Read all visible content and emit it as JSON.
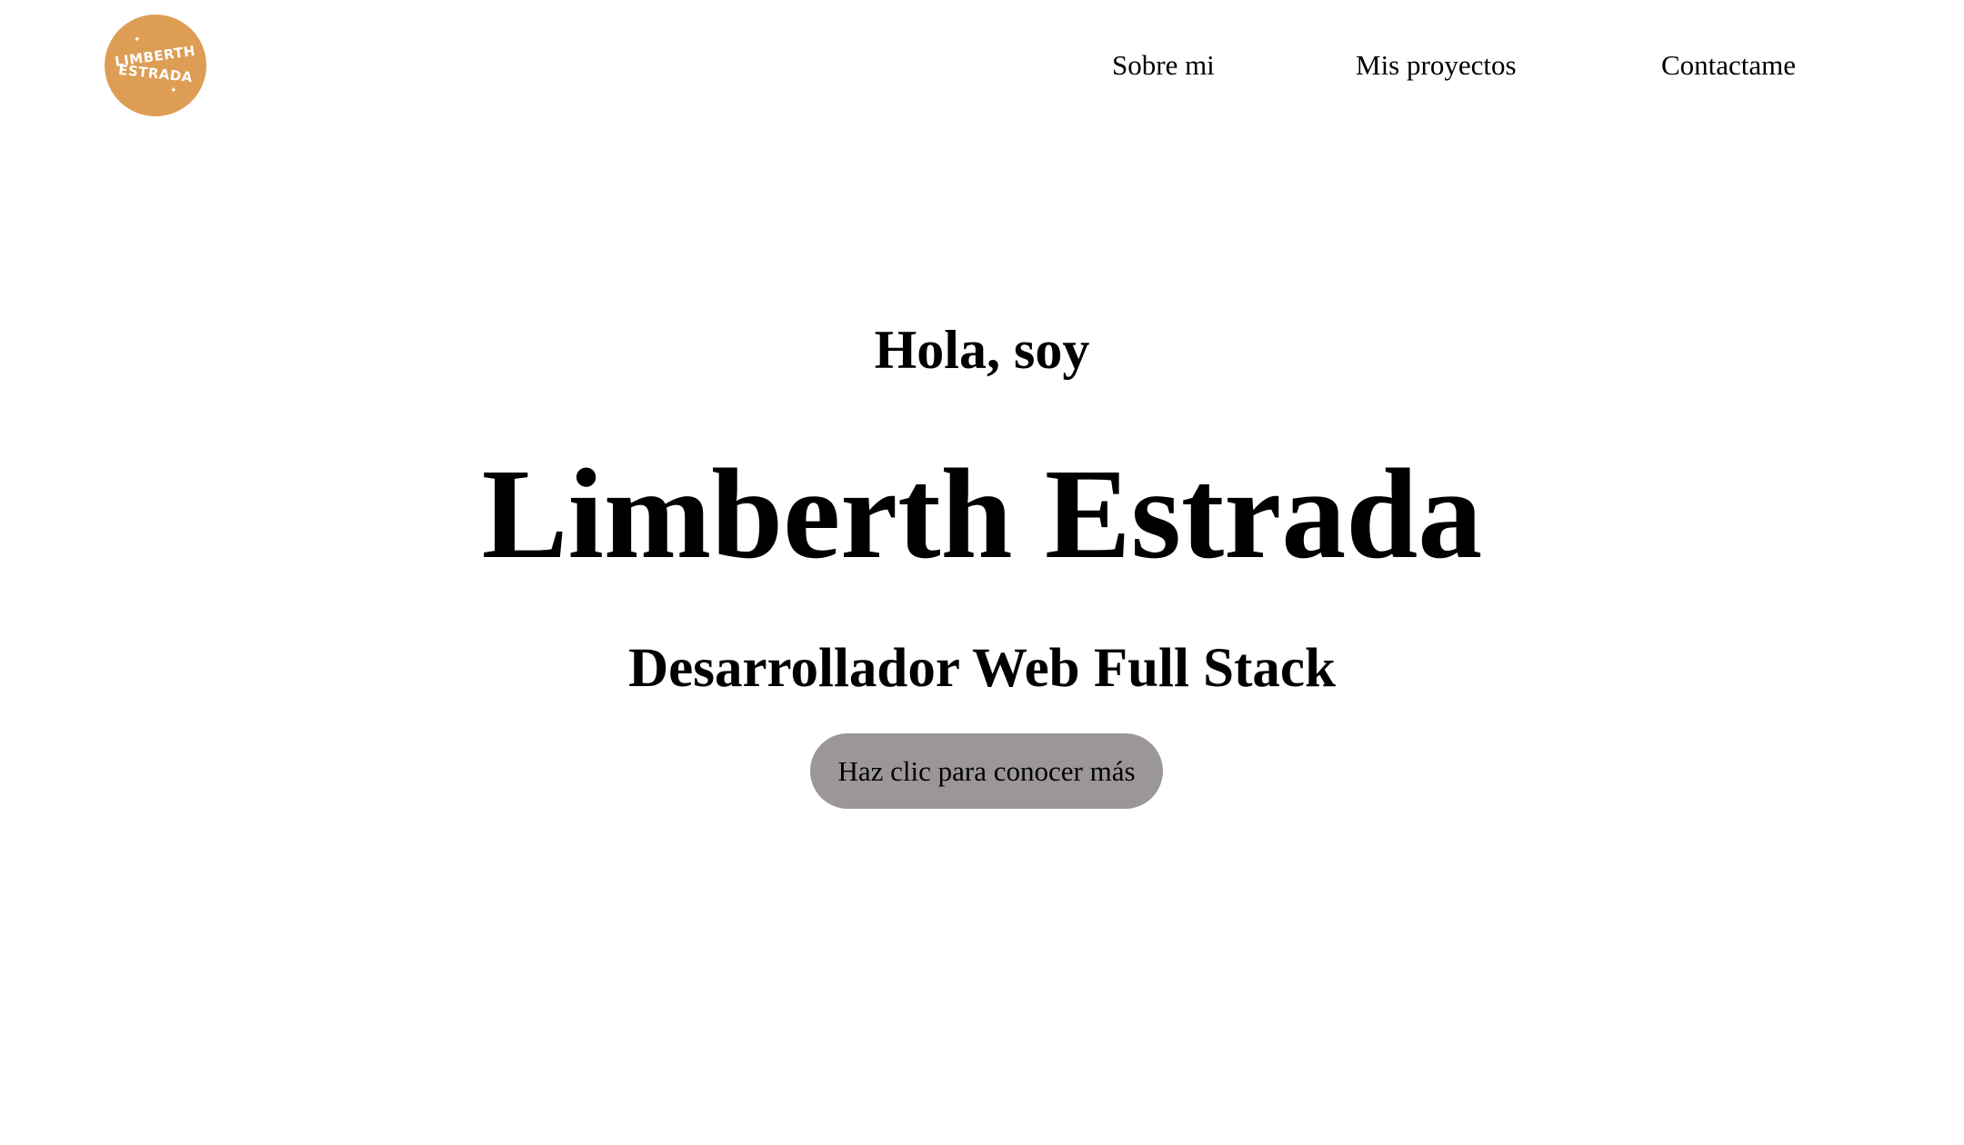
{
  "header": {
    "logo": {
      "line1": "LIMBERTH",
      "line2": "ESTRADA",
      "color": "#dd9d55"
    },
    "nav": [
      {
        "label": "Sobre mi"
      },
      {
        "label": "Mis proyectos"
      },
      {
        "label": "Contactame"
      }
    ]
  },
  "hero": {
    "greeting": "Hola, soy",
    "name": "Limberth Estrada",
    "role": "Desarrollador Web Full Stack",
    "cta_label": "Haz clic para conocer más",
    "cta_color": "#9b9796"
  }
}
